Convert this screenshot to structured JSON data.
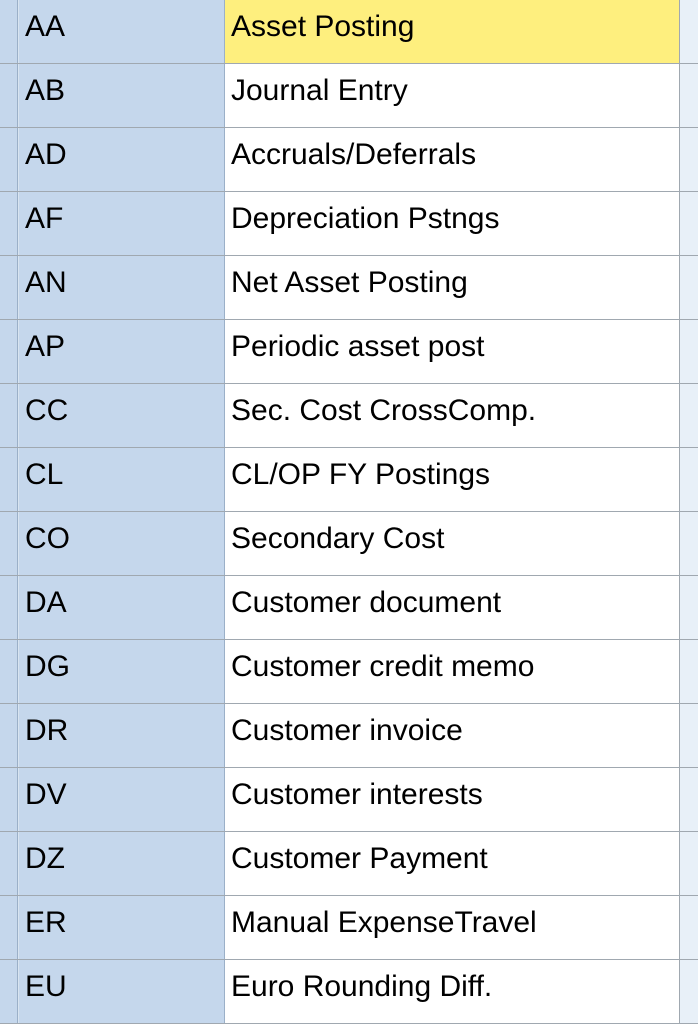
{
  "table": {
    "rows": [
      {
        "code": "AA",
        "desc": "Asset Posting",
        "selected": true
      },
      {
        "code": "AB",
        "desc": "Journal Entry",
        "selected": false
      },
      {
        "code": "AD",
        "desc": "Accruals/Deferrals",
        "selected": false
      },
      {
        "code": "AF",
        "desc": "Depreciation Pstngs",
        "selected": false
      },
      {
        "code": "AN",
        "desc": "Net Asset Posting",
        "selected": false
      },
      {
        "code": "AP",
        "desc": "Periodic asset post",
        "selected": false
      },
      {
        "code": "CC",
        "desc": "Sec. Cost CrossComp.",
        "selected": false
      },
      {
        "code": "CL",
        "desc": "CL/OP FY Postings",
        "selected": false
      },
      {
        "code": "CO",
        "desc": "Secondary Cost",
        "selected": false
      },
      {
        "code": "DA",
        "desc": "Customer document",
        "selected": false
      },
      {
        "code": "DG",
        "desc": "Customer credit memo",
        "selected": false
      },
      {
        "code": "DR",
        "desc": "Customer invoice",
        "selected": false
      },
      {
        "code": "DV",
        "desc": "Customer interests",
        "selected": false
      },
      {
        "code": "DZ",
        "desc": "Customer Payment",
        "selected": false
      },
      {
        "code": "ER",
        "desc": "Manual ExpenseTravel",
        "selected": false
      },
      {
        "code": "EU",
        "desc": "Euro Rounding Diff.",
        "selected": false
      }
    ]
  }
}
